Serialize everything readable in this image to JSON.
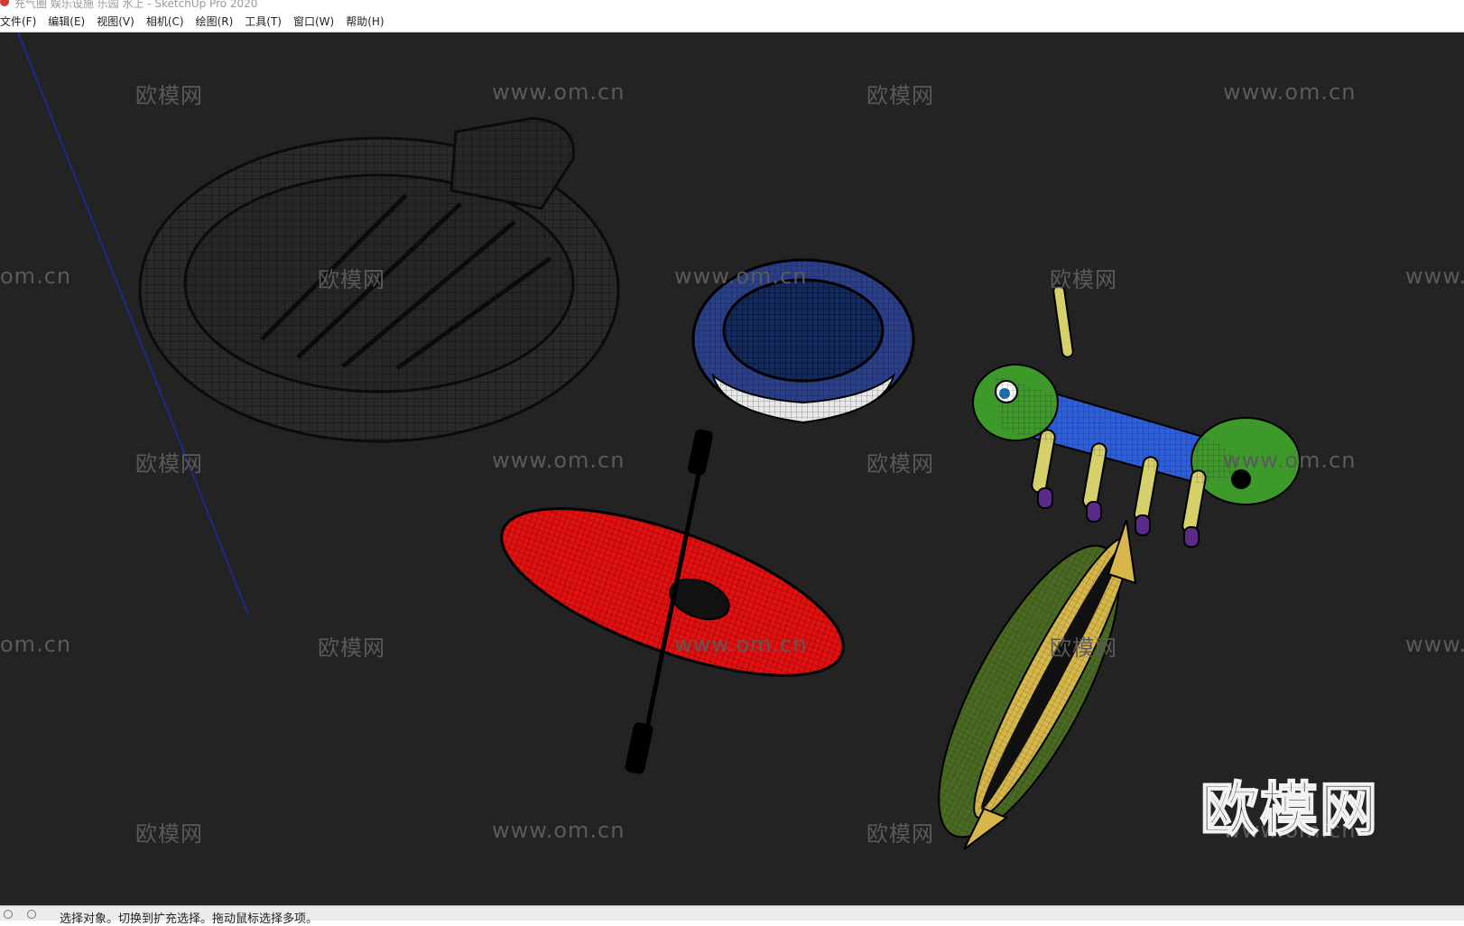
{
  "window": {
    "title": "充气圈 娱乐设施 乐园 水上 - SketchUp Pro 2020"
  },
  "menu": {
    "items": [
      "文件(F)",
      "编辑(E)",
      "视图(V)",
      "相机(C)",
      "绘图(R)",
      "工具(T)",
      "窗口(W)",
      "帮助(H)"
    ]
  },
  "watermark": {
    "logo_text": "欧模网",
    "url_text": "www.om.cn",
    "edge_left": "om.cn",
    "edge_right": "www.",
    "big_logo": "欧模网"
  },
  "status": {
    "hint": "选择对象。切换到扩充选择。拖动鼠标选择多项。"
  },
  "colors": {
    "background": "#232323",
    "kayak": "#e21010",
    "trampoline_blue": "#1a3a8a",
    "caterpillar_green": "#3d9a2a",
    "caterpillar_blue": "#2c5fe0",
    "banana_green": "#4a6a22",
    "banana_yellow": "#d7b74a"
  },
  "icons": [
    "app-icon",
    "info-icon",
    "help-icon"
  ]
}
